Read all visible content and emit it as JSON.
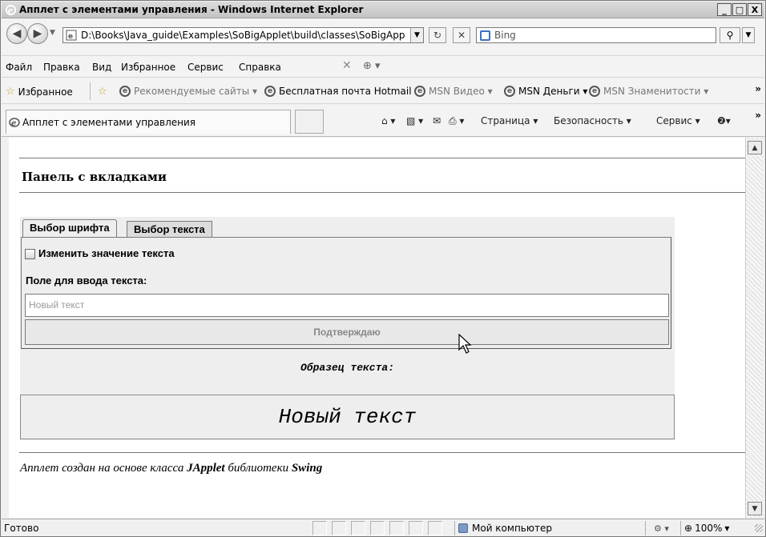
{
  "window": {
    "title": "Апплет с элементами управления - Windows Internet Explorer",
    "buttons": {
      "minimize": "_",
      "maximize": "□",
      "close": "X"
    }
  },
  "address_bar": {
    "url": "D:\\Books\\Java_guide\\Examples\\SoBigApplet\\build\\classes\\SoBigApp",
    "search_placeholder": "Bing"
  },
  "menu": {
    "items": [
      "Файл",
      "Правка",
      "Вид",
      "Избранное",
      "Сервис",
      "Справка"
    ]
  },
  "favorites": {
    "label": "Избранное",
    "links": [
      {
        "label": "Рекомендуемые сайты ▾",
        "dim": true
      },
      {
        "label": "Бесплатная почта Hotmail",
        "dim": false
      },
      {
        "label": "MSN Видео ▾",
        "dim": true
      },
      {
        "label": "MSN Деньги ▾",
        "dim": false
      },
      {
        "label": "MSN Знаменитости ▾",
        "dim": true
      }
    ],
    "overflow": "»"
  },
  "tabbar": {
    "tab_title": "Апплет с элементами управления",
    "commands": {
      "page": "Страница ▾",
      "security": "Безопасность ▾",
      "tools": "Сервис ▾"
    },
    "overflow": "»"
  },
  "page": {
    "heading": "Панель с вкладками",
    "applet": {
      "tabs": [
        "Выбор шрифта",
        "Выбор текста"
      ],
      "active_tab": 0,
      "checkbox_label": "Изменить значение текста",
      "checkbox_checked": false,
      "field_label": "Поле для ввода текста:",
      "input_placeholder": "Новый текст",
      "confirm_label": "Подтверждаю",
      "sample_label": "Образец текста:",
      "sample_text": "Новый текст"
    },
    "footer_note_prefix": "Апплет создан на основе класса ",
    "footer_note_class": "JApplet",
    "footer_note_middle": " библиотеки ",
    "footer_note_lib": "Swing"
  },
  "statusbar": {
    "status": "Готово",
    "zone": "Мой компьютер",
    "zoom": "100%"
  }
}
